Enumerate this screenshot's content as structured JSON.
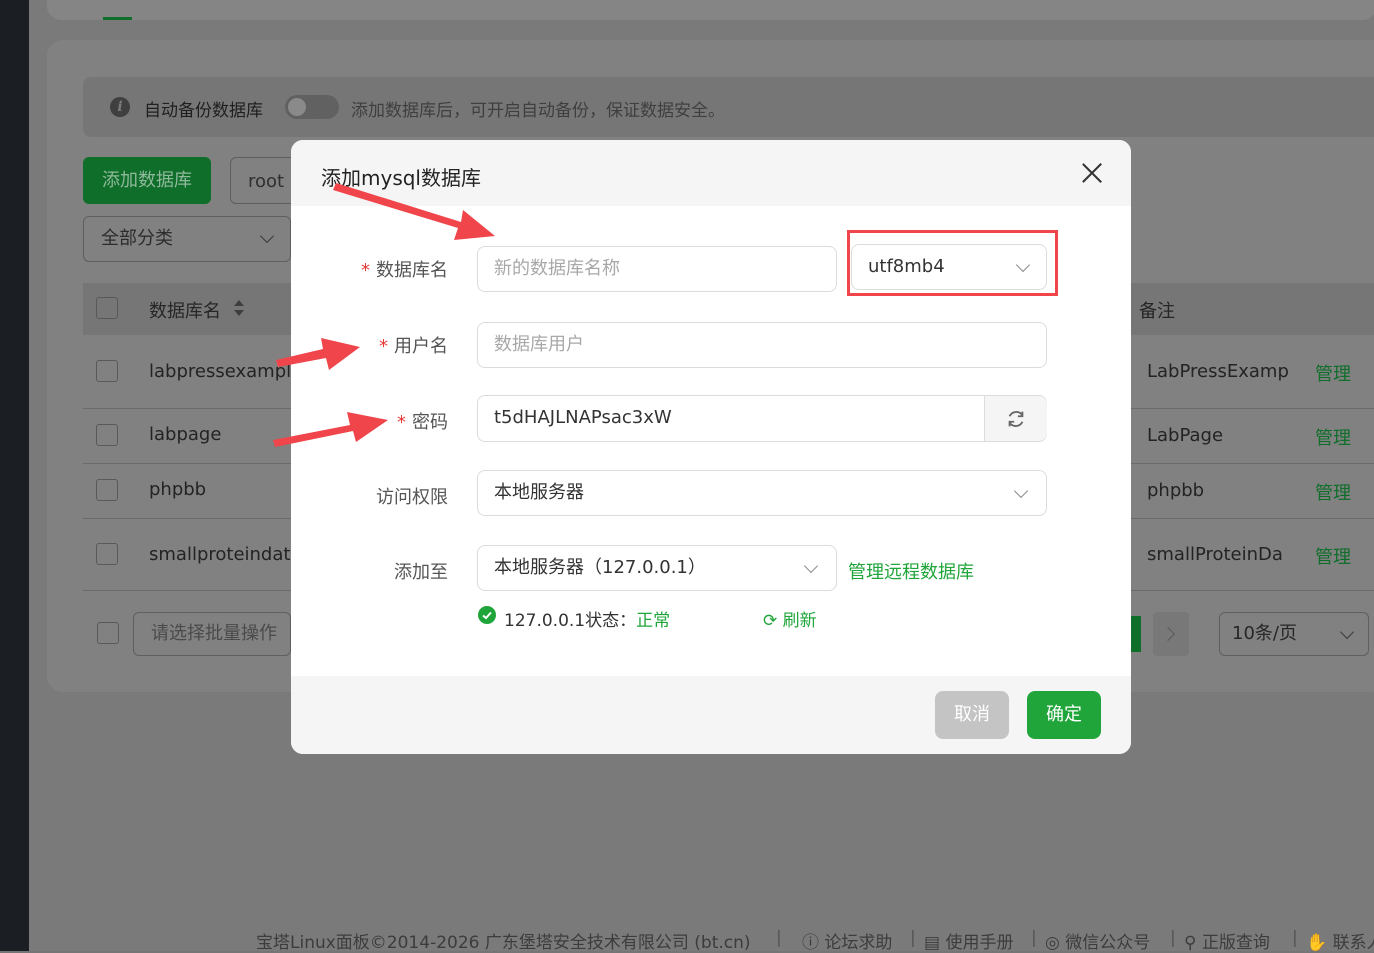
{
  "background": {
    "notice_label": "自动备份数据库",
    "notice_text": "添加数据库后，可开启自动备份，保证数据安全。",
    "add_db_button": "添加数据库",
    "root_button": "root密",
    "category_select": "全部分类",
    "col_name": "数据库名",
    "col_remark": "备注",
    "rows": [
      {
        "name": "labpressexample",
        "remark": "LabPressExamp",
        "action": "管理"
      },
      {
        "name": "labpage",
        "remark": "LabPage",
        "action": "管理"
      },
      {
        "name": "phpbb",
        "remark": "phpbb",
        "action": "管理"
      },
      {
        "name": "smallproteindata",
        "remark": "smallProteinDa",
        "action": "管理"
      }
    ],
    "batch_placeholder": "请选择批量操作",
    "page_size": "10条/页",
    "footer": {
      "copyright": "宝塔Linux面板©2014-2026 广东堡塔安全技术有限公司 (bt.cn)",
      "forum": "论坛求助",
      "manual": "使用手册",
      "wechat": "微信公众号",
      "license": "正版查询",
      "contact": "联系人"
    }
  },
  "modal": {
    "title": "添加mysql数据库",
    "fields": {
      "db_name_label": "数据库名",
      "db_name_placeholder": "新的数据库名称",
      "charset": "utf8mb4",
      "user_label": "用户名",
      "user_placeholder": "数据库用户",
      "password_label": "密码",
      "password_value": "t5dHAJLNAPsac3xW",
      "access_label": "访问权限",
      "access_value": "本地服务器",
      "add_to_label": "添加至",
      "add_to_value": "本地服务器（127.0.0.1）",
      "manage_remote": "管理远程数据库",
      "status_prefix": "127.0.0.1状态：",
      "status_value": "正常",
      "refresh": "刷新"
    },
    "cancel": "取消",
    "confirm": "确定"
  },
  "colors": {
    "accent": "#20a53a",
    "annotation": "#f0454a"
  }
}
